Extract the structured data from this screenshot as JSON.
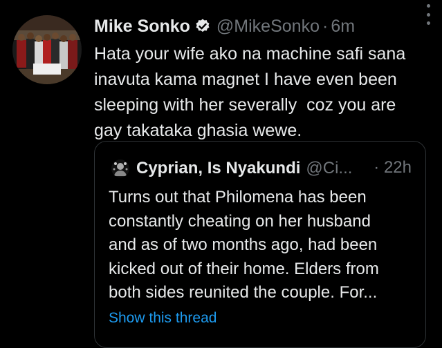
{
  "tweet": {
    "author": {
      "display_name": "Mike Sonko",
      "handle": "@MikeSonko",
      "verified_icon": "verified-badge-icon",
      "avatar": "profile-photo"
    },
    "separator": "·",
    "timestamp": "6m",
    "more_icon": "more-vertical-icon",
    "text_lines": [
      "Hata your wife ako na machine safi sana",
      "inavuta kama magnet I have even been",
      "sleeping with her severally  coz you are",
      "gay takataka ghasia wewe."
    ]
  },
  "quoted_tweet": {
    "author": {
      "display_name": "Cyprian, Is Nyakundi",
      "handle": "@Ci...",
      "avatar": "profile-photo"
    },
    "separator": "·",
    "timestamp": "22h",
    "text_lines": [
      "Turns out that Philomena has been",
      "constantly cheating on her husband",
      "and as of two months ago, had been",
      "kicked out of their home. Elders from",
      "both sides reunited the couple. For..."
    ],
    "show_thread_label": "Show this thread"
  },
  "colors": {
    "background": "#000000",
    "text_primary": "#e7e9ea",
    "text_secondary": "#71767b",
    "link": "#1d9bf0",
    "border": "#2f3336"
  }
}
